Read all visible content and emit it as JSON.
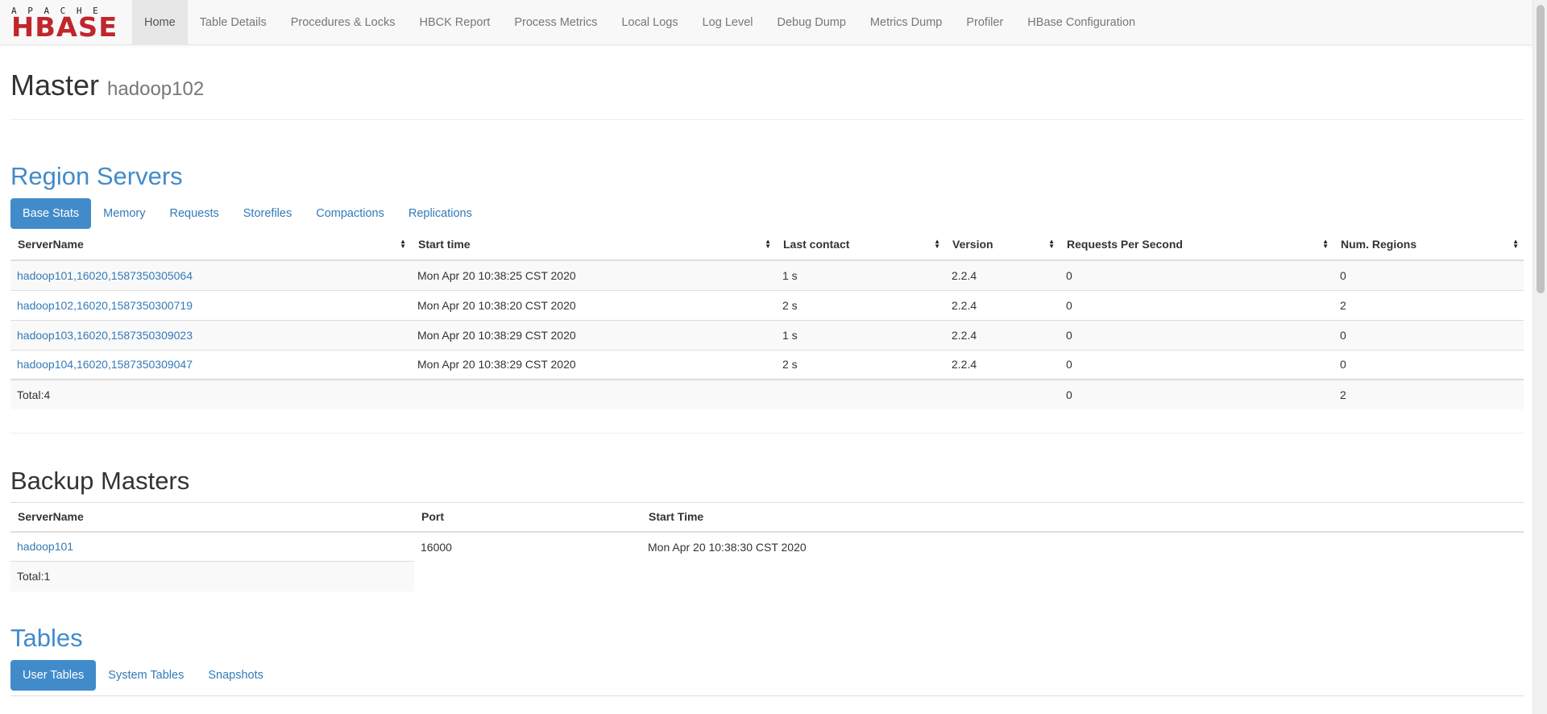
{
  "brand": {
    "top": "APACHE",
    "main": "HBASE"
  },
  "nav": [
    {
      "label": "Home",
      "active": true
    },
    {
      "label": "Table Details"
    },
    {
      "label": "Procedures & Locks"
    },
    {
      "label": "HBCK Report"
    },
    {
      "label": "Process Metrics"
    },
    {
      "label": "Local Logs"
    },
    {
      "label": "Log Level"
    },
    {
      "label": "Debug Dump"
    },
    {
      "label": "Metrics Dump"
    },
    {
      "label": "Profiler"
    },
    {
      "label": "HBase Configuration"
    }
  ],
  "header": {
    "title": "Master",
    "host": "hadoop102"
  },
  "region_servers": {
    "title": "Region Servers",
    "tabs": [
      "Base Stats",
      "Memory",
      "Requests",
      "Storefiles",
      "Compactions",
      "Replications"
    ],
    "columns": [
      "ServerName",
      "Start time",
      "Last contact",
      "Version",
      "Requests Per Second",
      "Num. Regions"
    ],
    "rows": [
      [
        "hadoop101,16020,1587350305064",
        "Mon Apr 20 10:38:25 CST 2020",
        "1 s",
        "2.2.4",
        "0",
        "0"
      ],
      [
        "hadoop102,16020,1587350300719",
        "Mon Apr 20 10:38:20 CST 2020",
        "2 s",
        "2.2.4",
        "0",
        "2"
      ],
      [
        "hadoop103,16020,1587350309023",
        "Mon Apr 20 10:38:29 CST 2020",
        "1 s",
        "2.2.4",
        "0",
        "0"
      ],
      [
        "hadoop104,16020,1587350309047",
        "Mon Apr 20 10:38:29 CST 2020",
        "2 s",
        "2.2.4",
        "0",
        "0"
      ]
    ],
    "total": {
      "label": "Total:4",
      "requests": "0",
      "regions": "2"
    }
  },
  "backup_masters": {
    "title": "Backup Masters",
    "columns": [
      "ServerName",
      "Port",
      "Start Time"
    ],
    "rows": [
      [
        "hadoop101",
        "16000",
        "Mon Apr 20 10:38:30 CST 2020"
      ]
    ],
    "total": "Total:1"
  },
  "tables": {
    "title": "Tables",
    "tabs": [
      "User Tables",
      "System Tables",
      "Snapshots"
    ]
  }
}
